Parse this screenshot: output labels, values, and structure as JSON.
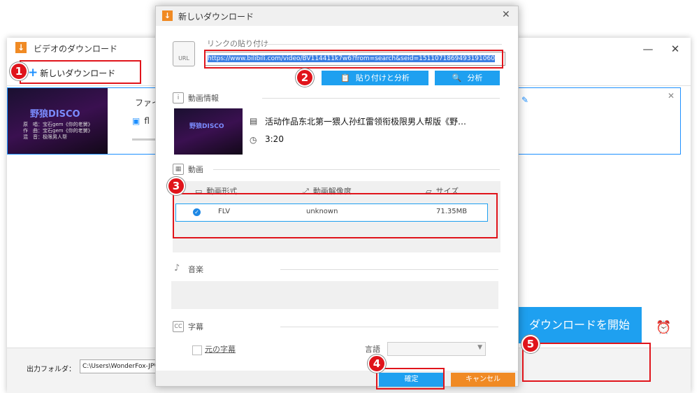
{
  "main_window": {
    "title": "ビデオのダウンロード",
    "controls": {
      "minimize": "—",
      "close": "✕"
    },
    "new_download_label": "新しいダウンロード",
    "task": {
      "thumb_title": "野狼DISCO",
      "thumb_credits": "原　唱：宝石gem《你的老舅》\n作　曲：宝石gem《你的老舅》\n混　音：极限男人帮",
      "file_label": "ファイ",
      "format": "fl",
      "close": "✕"
    },
    "output_folder_label": "出力フォルダ：",
    "output_folder_path": "C:\\Users\\WonderFox-JP\\",
    "start_button": "ダウンロードを開始"
  },
  "dialog": {
    "title": "新しいダウンロード",
    "close": "✕",
    "paste_label": "リンクの貼り付け",
    "url_icon_text": "URL",
    "url_value": "https://www.bilibili.com/video/BV114411k7w6?from=search&seid=1511071869493191060",
    "paste_analyze_button": "貼り付けと分析",
    "analyze_button": "分析",
    "video_info_label": "動画情報",
    "video_thumb_title": "野狼DISCO",
    "video_title": "活动作品东北第一猥人孙红雷领衔极限男人帮版《野…",
    "duration": "3:20",
    "video_section_label": "動画",
    "columns": [
      "動画形式",
      "動画解像度",
      "サイズ"
    ],
    "rows": [
      {
        "format": "FLV",
        "resolution": "unknown",
        "size": "71.35MB"
      }
    ],
    "music_label": "音楽",
    "subtitle_label": "字幕",
    "subtitle_original": "元の字幕",
    "language_label": "言語",
    "ok_button": "確定",
    "cancel_button": "キャンセル"
  },
  "annotations": [
    "1",
    "2",
    "3",
    "4",
    "5"
  ],
  "colors": {
    "accent_blue": "#1ea0f0",
    "orange": "#f08a24",
    "annotation_red": "#e0141b"
  }
}
